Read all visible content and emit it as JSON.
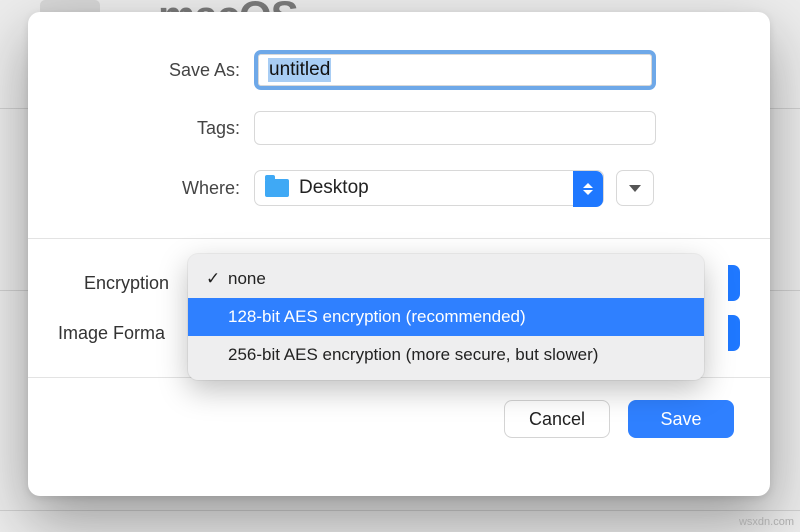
{
  "background": {
    "title": "macOS"
  },
  "dialog": {
    "saveAs": {
      "label": "Save As:",
      "value": "untitled"
    },
    "tags": {
      "label": "Tags:",
      "value": ""
    },
    "where": {
      "label": "Where:",
      "value": "Desktop"
    },
    "encryption": {
      "label": "Encryption",
      "options": [
        {
          "label": "none",
          "checked": true,
          "selected": false
        },
        {
          "label": "128-bit AES encryption (recommended)",
          "checked": false,
          "selected": true
        },
        {
          "label": "256-bit AES encryption (more secure, but slower)",
          "checked": false,
          "selected": false
        }
      ]
    },
    "imageFormat": {
      "label": "Image Forma"
    },
    "buttons": {
      "cancel": "Cancel",
      "save": "Save"
    }
  },
  "watermark": "wsxdn.com"
}
